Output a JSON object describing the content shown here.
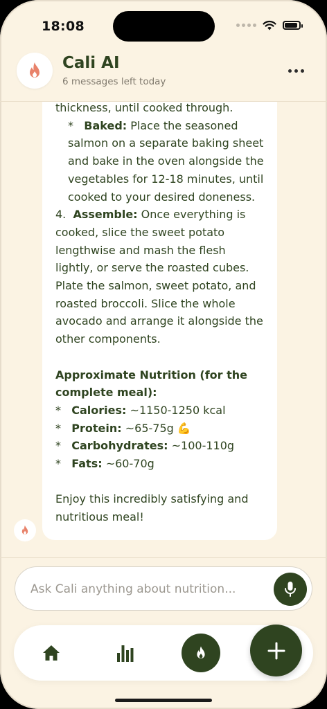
{
  "status_bar": {
    "time": "18:08"
  },
  "header": {
    "title": "Cali AI",
    "subtitle": "6 messages left today",
    "avatar_icon": "flame-icon",
    "menu_icon": "more-horizontal-icon"
  },
  "message": {
    "line_top": "thickness, until cooked through.",
    "baked_bullet": "*",
    "baked_label": "Baked:",
    "baked_text": "Place the seasoned salmon on a separate baking sheet and bake in the oven alongside the vegetables for 12-18 minutes, until cooked to your desired doneness.",
    "step4_number": "4.",
    "step4_label": "Assemble:",
    "step4_text": "Once everything is cooked, slice the sweet potato lengthwise and mash the flesh lightly, or serve the roasted cubes. Plate the salmon, sweet potato, and roasted broccoli. Slice the whole avocado and arrange it alongside the other components.",
    "nutrition_heading": "Approximate Nutrition (for the complete meal):",
    "nutrition": [
      {
        "bullet": "*",
        "label": "Calories:",
        "value": "~1150-1250 kcal"
      },
      {
        "bullet": "*",
        "label": "Protein:",
        "value": "~65-75g 💪"
      },
      {
        "bullet": "*",
        "label": "Carbohydrates:",
        "value": "~100-110g"
      },
      {
        "bullet": "*",
        "label": "Fats:",
        "value": "~60-70g"
      }
    ],
    "closing": "Enjoy this incredibly satisfying and nutritious meal!"
  },
  "input": {
    "placeholder": "Ask Cali anything about nutrition...",
    "mic_icon": "microphone-icon"
  },
  "nav": {
    "items": [
      {
        "name": "home",
        "icon": "home-icon"
      },
      {
        "name": "stats",
        "icon": "bar-chart-icon"
      },
      {
        "name": "cali",
        "icon": "flame-icon"
      }
    ],
    "fab_icon": "plus-icon"
  },
  "colors": {
    "background": "#fbf3e3",
    "primary": "#2f4420",
    "bubble": "#ffffff",
    "flame": "#e8826a",
    "muted": "#807a6e"
  }
}
